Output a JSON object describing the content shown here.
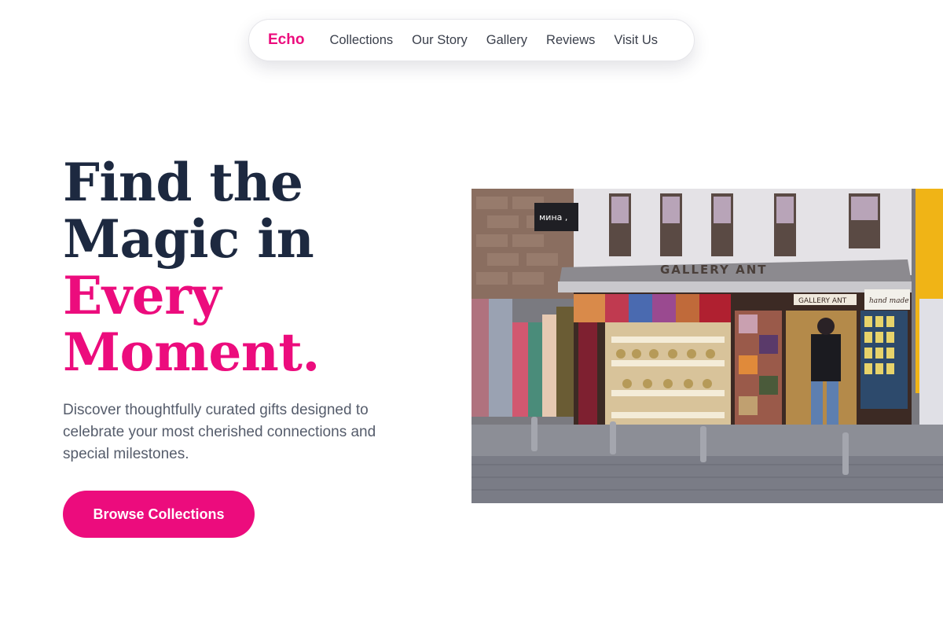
{
  "nav": {
    "brand": "Echo",
    "links": [
      "Collections",
      "Our Story",
      "Gallery",
      "Reviews",
      "Visit Us"
    ]
  },
  "hero": {
    "title_line1": "Find the",
    "title_line2": "Magic in",
    "title_line3": "Every",
    "title_line4": "Moment.",
    "description": "Discover thoughtfully curated gifts designed to celebrate your most cherished connections and special milestones.",
    "cta_label": "Browse Collections"
  },
  "photo": {
    "shop_sign": "GALLERY ANT",
    "small_sign": "мина ,",
    "door_sign": "GALLERY ANT",
    "note": "hand made"
  },
  "colors": {
    "accent": "#ec0c7d",
    "heading": "#1d2940",
    "body_text": "#555c6b"
  }
}
